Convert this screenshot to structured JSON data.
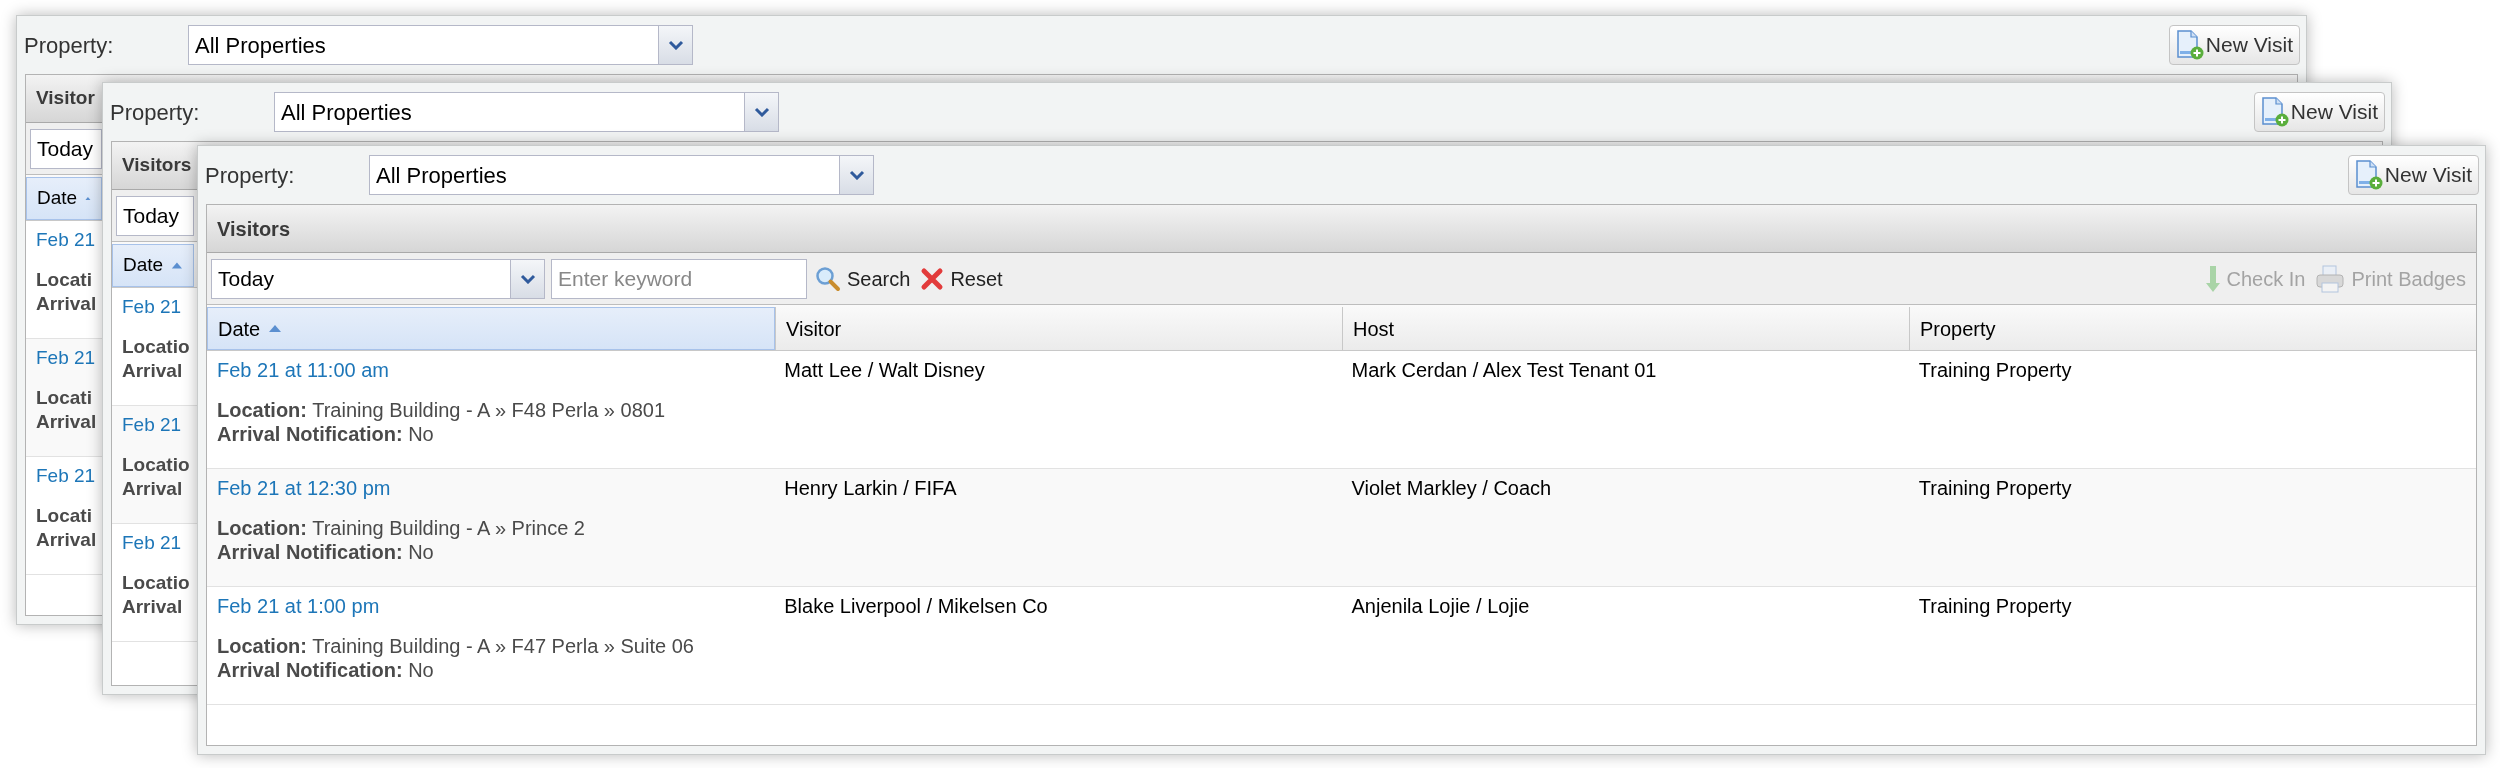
{
  "windows": [
    {
      "kind": "back",
      "property_label": "Property:",
      "property_value": "All Properties",
      "new_visit": "New Visit",
      "title": "Visitor",
      "period": "Today",
      "columns": [
        {
          "label": "Date",
          "sorted": true
        }
      ],
      "rows": [
        {
          "date": "Feb 21",
          "location": "Locati",
          "arrival": "Arrival"
        },
        {
          "date": "Feb 21",
          "location": "Locati",
          "arrival": "Arrival"
        },
        {
          "date": "Feb 21",
          "location": "Locati",
          "arrival": "Arrival"
        }
      ]
    },
    {
      "kind": "back",
      "property_label": "Property:",
      "property_value": "All Properties",
      "new_visit": "New Visit",
      "title": "Visitors",
      "period": "Today",
      "columns": [
        {
          "label": "Date",
          "sorted": true
        }
      ],
      "rows": [
        {
          "date": "Feb 21",
          "location": "Locatio",
          "arrival": "Arrival"
        },
        {
          "date": "Feb 21",
          "location": "Locatio",
          "arrival": "Arrival"
        },
        {
          "date": "Feb 21",
          "location": "Locatio",
          "arrival": "Arrival"
        }
      ]
    },
    {
      "kind": "front",
      "property_label": "Property:",
      "property_value": "All Properties",
      "new_visit": "New Visit",
      "title": "Visitors",
      "period": "Today",
      "keyword_placeholder": "Enter keyword",
      "search": "Search",
      "reset": "Reset",
      "actions": [
        {
          "kind": "checkin",
          "label": "Check In",
          "disabled": true
        },
        {
          "kind": "print",
          "label": "Print Badges",
          "disabled": true
        }
      ],
      "columns": [
        {
          "label": "Date",
          "sorted": true
        },
        {
          "label": "Visitor",
          "sorted": false
        },
        {
          "label": "Host",
          "sorted": false
        },
        {
          "label": "Property",
          "sorted": false
        }
      ],
      "rows": [
        {
          "date": "Feb 21 at 11:00 am",
          "location": "**Location:** Training Building - A » F48 Perla » 0801",
          "arrival": "**Arrival Notification:** No",
          "visitor": "Matt Lee / Walt Disney",
          "host": "Mark Cerdan / Alex Test Tenant 01",
          "property": "Training Property"
        },
        {
          "date": "Feb 21 at 12:30 pm",
          "location": "**Location:** Training Building - A » Prince 2",
          "arrival": "**Arrival Notification:** No",
          "visitor": "Henry Larkin / FIFA",
          "host": "Violet Markley / Coach",
          "property": "Training Property"
        },
        {
          "date": "Feb 21 at 1:00 pm",
          "location": "**Location:** Training Building - A » F47 Perla » Suite 06",
          "arrival": "**Arrival Notification:** No",
          "visitor": "Blake Liverpool / Mikelsen Co",
          "host": "Anjenila Lojie / Lojie",
          "property": "Training Property"
        }
      ]
    }
  ]
}
